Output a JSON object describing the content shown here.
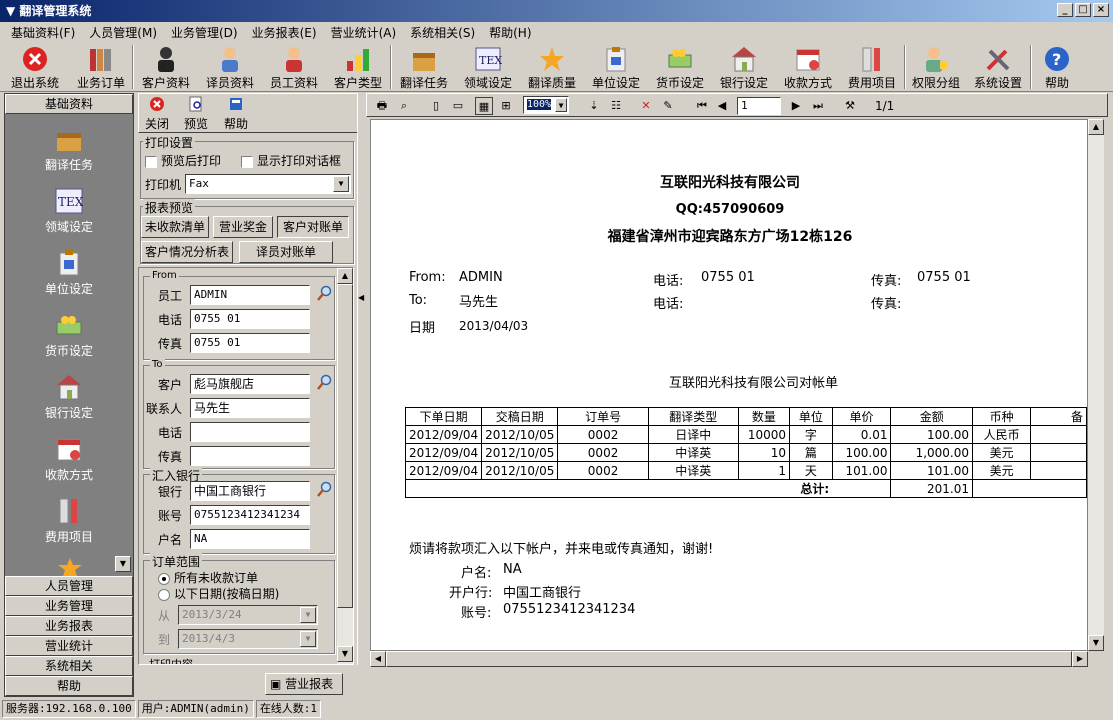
{
  "window": {
    "title": "翻译管理系统",
    "min": "_",
    "max": "□",
    "close": "×"
  },
  "menu": [
    "基础资料(F)",
    "人员管理(M)",
    "业务管理(D)",
    "业务报表(E)",
    "营业统计(A)",
    "系统相关(S)",
    "帮助(H)"
  ],
  "toolbar": [
    "退出系统",
    "业务订单",
    "客户资料",
    "译员资料",
    "员工资料",
    "客户类型",
    "翻译任务",
    "领域设定",
    "翻译质量",
    "单位设定",
    "货币设定",
    "银行设定",
    "收款方式",
    "费用项目",
    "权限分组",
    "系统设置",
    "帮助"
  ],
  "sidebar": {
    "header": "基础资料",
    "items": [
      "翻译任务",
      "领域设定",
      "单位设定",
      "货币设定",
      "银行设定",
      "收款方式",
      "费用项目"
    ],
    "sections": [
      "人员管理",
      "业务管理",
      "业务报表",
      "营业统计",
      "系统相关",
      "帮助"
    ]
  },
  "panel": {
    "buttons": [
      "关闭",
      "预览",
      "帮助"
    ],
    "print_settings": {
      "label": "打印设置",
      "preview_after": "预览后打印",
      "show_dialog": "显示打印对话框",
      "printer_label": "打印机",
      "printer": "Fax"
    },
    "report_preview": {
      "label": "报表预览",
      "tabs": [
        "未收款清单",
        "营业奖金",
        "客户对账单",
        "客户情况分析表",
        "译员对账单"
      ]
    },
    "from": {
      "label": "From",
      "staff_label": "员工",
      "staff": "ADMIN",
      "phone_label": "电话",
      "phone": "0755 01",
      "fax_label": "传真",
      "fax": "0755 01"
    },
    "to": {
      "label": "To",
      "customer_label": "客户",
      "customer": "彪马旗舰店",
      "contact_label": "联系人",
      "contact": "马先生",
      "phone_label": "电话",
      "phone": "",
      "fax_label": "传真",
      "fax": ""
    },
    "bank": {
      "label": "汇入银行",
      "bank_label": "银行",
      "bank": "中国工商银行",
      "account_label": "账号",
      "account": "0755123412341234",
      "name_label": "户名",
      "name": "NA"
    },
    "range": {
      "label": "订单范围",
      "opt1": "所有未收款订单",
      "opt2": "以下日期(按稿日期)",
      "from_label": "从",
      "from": "2013/3/24",
      "to_label": "到",
      "to": "2013/4/3"
    },
    "print_content": "打印内容"
  },
  "preview_toolbar": {
    "zoom": "100%",
    "page": "1",
    "pages": "1/1"
  },
  "report": {
    "company": "互联阳光科技有限公司",
    "qq": "QQ:457090609",
    "address": "福建省漳州市迎宾路东方广场12栋126",
    "from_label": "From:",
    "from": "ADMIN",
    "to_label": "To:",
    "to": "马先生",
    "date_label": "日期",
    "date": "2013/04/03",
    "phone_label": "电话:",
    "phone1": "0755 01",
    "fax_label": "传真:",
    "fax1": "0755 01",
    "title": "互联阳光科技有限公司对帐单",
    "headers": [
      "下单日期",
      "交稿日期",
      "订单号",
      "翻译类型",
      "数量",
      "单位",
      "单价",
      "金额",
      "币种",
      "备"
    ],
    "rows": [
      [
        "2012/09/04",
        "2012/10/05",
        "0002",
        "日译中",
        "10000",
        "字",
        "0.01",
        "100.00",
        "人民币"
      ],
      [
        "2012/09/04",
        "2012/10/05",
        "0002",
        "中译英",
        "10",
        "篇",
        "100.00",
        "1,000.00",
        "美元"
      ],
      [
        "2012/09/04",
        "2012/10/05",
        "0002",
        "中译英",
        "1",
        "天",
        "101.00",
        "101.00",
        "美元"
      ]
    ],
    "total_label": "总计:",
    "total": "201.01",
    "note": "烦请将款项汇入以下帐户，并来电或传真通知，谢谢!",
    "acct_name_label": "户名:",
    "acct_name": "NA",
    "acct_bank_label": "开户行:",
    "acct_bank": "中国工商银行",
    "acct_no_label": "账号:",
    "acct_no": "0755123412341234"
  },
  "tab": "营业报表",
  "status": {
    "server": "服务器:192.168.0.100",
    "user": "用户:ADMIN(admin)",
    "online": "在线人数:1"
  },
  "colors": {
    "titlebar": "#0a246a",
    "sidebar": "#808080",
    "face": "#d4d0c8"
  }
}
